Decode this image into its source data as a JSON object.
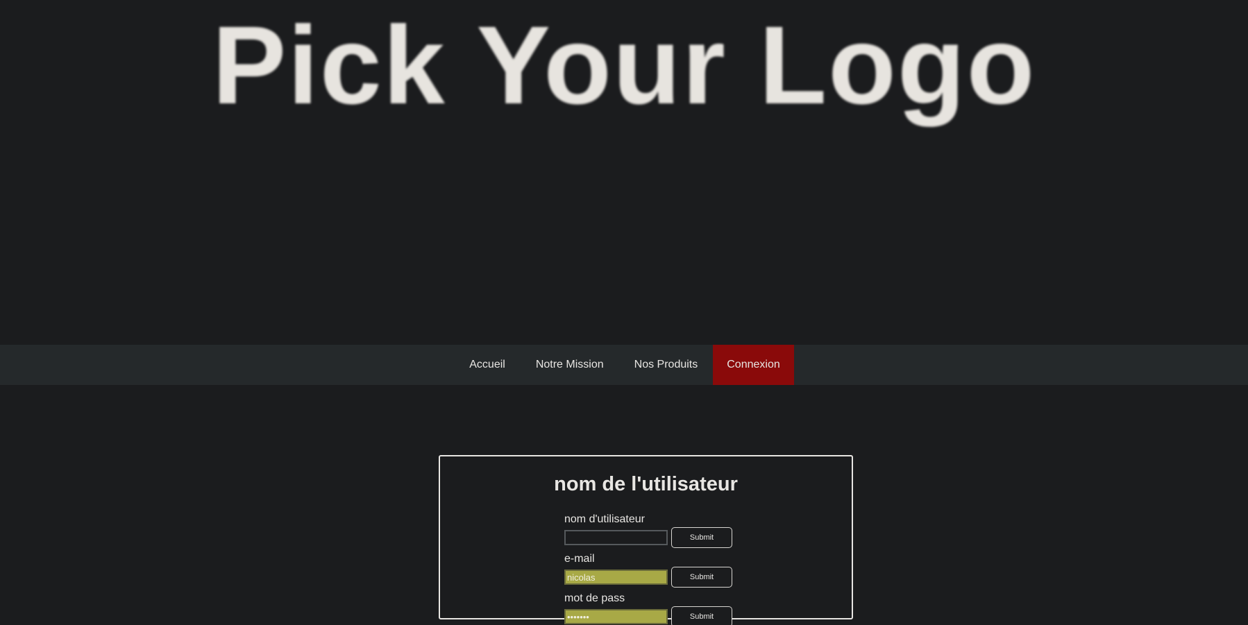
{
  "header": {
    "logo_text": "Pick Your Logo"
  },
  "nav": {
    "items": [
      {
        "label": "Accueil",
        "active": false
      },
      {
        "label": "Notre Mission",
        "active": false
      },
      {
        "label": "Nos Produits",
        "active": false
      },
      {
        "label": "Connexion",
        "active": true
      }
    ],
    "active_color": "#8a0a0a"
  },
  "form": {
    "title": "nom de l'utilisateur",
    "fields": [
      {
        "label": "nom d'utilisateur",
        "value": "",
        "type": "text",
        "submit_label": "Submit"
      },
      {
        "label": "e-mail",
        "value": "nicolas",
        "type": "text",
        "submit_label": "Submit"
      },
      {
        "label": "mot de pass",
        "value": "•••••••",
        "type": "password",
        "submit_label": "Submit"
      }
    ],
    "autofill_color": "#a8a946"
  }
}
